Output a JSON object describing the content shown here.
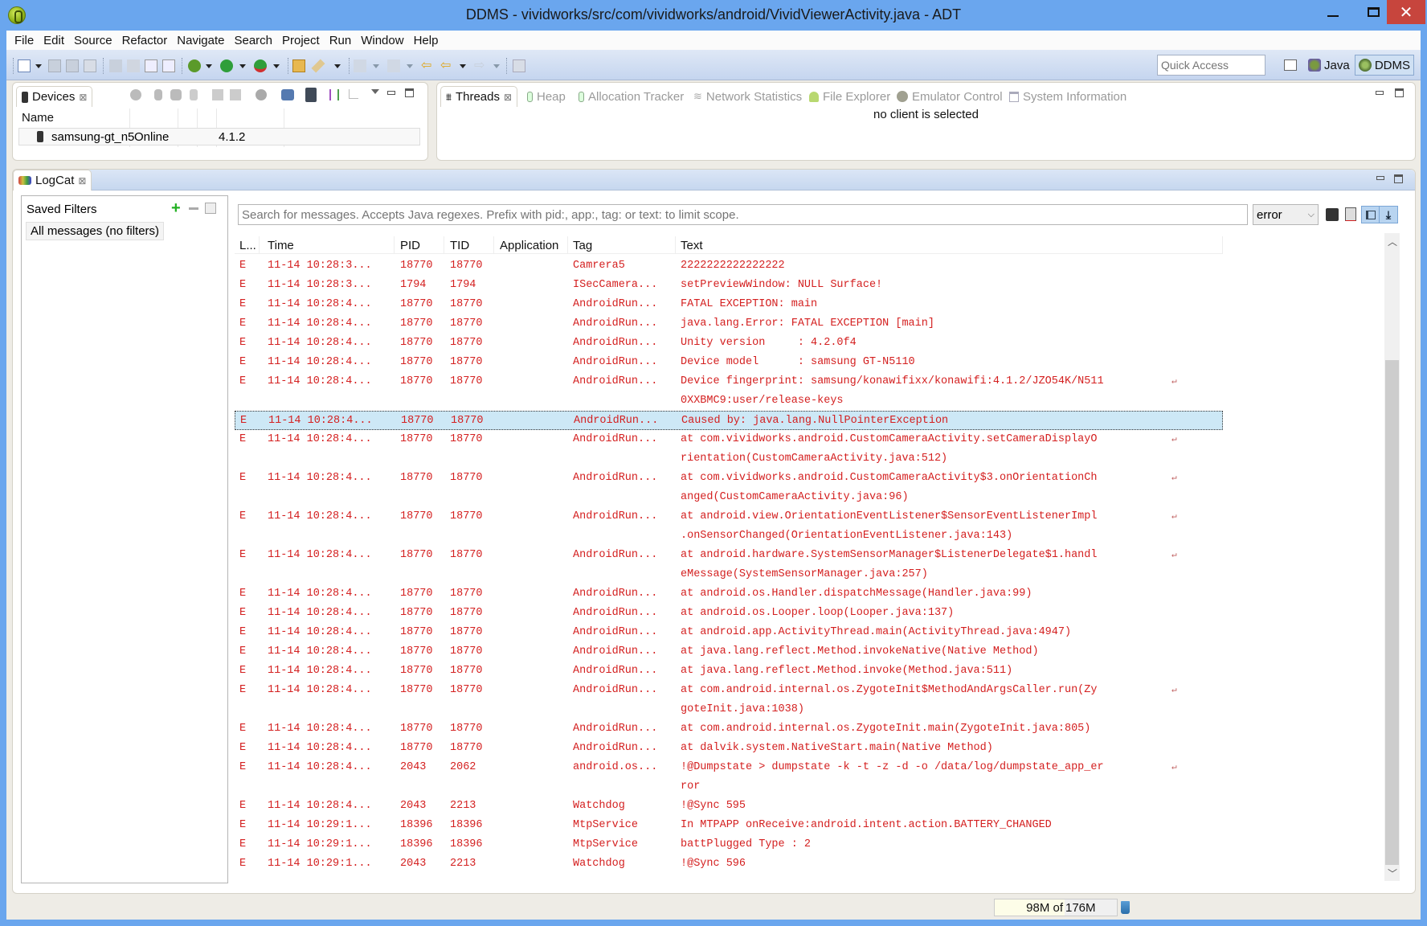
{
  "window": {
    "title": "DDMS - vividworks/src/com/vividworks/android/VividViewerActivity.java - ADT",
    "minimize": "minimize",
    "maximize": "maximize",
    "close": "✕"
  },
  "menu": [
    "File",
    "Edit",
    "Source",
    "Refactor",
    "Navigate",
    "Search",
    "Project",
    "Run",
    "Window",
    "Help"
  ],
  "toolbar": {
    "quick_access_placeholder": "Quick Access",
    "perspectives": [
      {
        "label": "Java",
        "active": false
      },
      {
        "label": "DDMS",
        "active": true
      }
    ]
  },
  "devices": {
    "tab_label": "Devices",
    "columns": [
      "Name",
      "",
      "",
      "",
      ""
    ],
    "rows": [
      {
        "name": "samsung-gt_n5",
        "status": "Online",
        "version": "4.1.2"
      }
    ]
  },
  "client_tabs": {
    "tabs": [
      {
        "label": "Threads",
        "active": true
      },
      {
        "label": "Heap",
        "active": false
      },
      {
        "label": "Allocation Tracker",
        "active": false
      },
      {
        "label": "Network Statistics",
        "active": false
      },
      {
        "label": "File Explorer",
        "active": false
      },
      {
        "label": "Emulator Control",
        "active": false
      },
      {
        "label": "System Information",
        "active": false
      }
    ],
    "message": "no client is selected"
  },
  "logcat": {
    "tab_label": "LogCat",
    "saved_filters_label": "Saved Filters",
    "filters": [
      "All messages (no filters)"
    ],
    "search_placeholder": "Search for messages. Accepts Java regexes. Prefix with pid:, app:, tag: or text: to limit scope.",
    "level": "error",
    "columns": [
      "L...",
      "Time",
      "PID",
      "TID",
      "Application",
      "Tag",
      "Text"
    ],
    "rows": [
      {
        "level": "E",
        "time": "11-14 10:28:3...",
        "pid": "18770",
        "tid": "18770",
        "app": "",
        "tag": "Camrera5",
        "text": [
          "2222222222222222"
        ]
      },
      {
        "level": "E",
        "time": "11-14 10:28:3...",
        "pid": "1794",
        "tid": "1794",
        "app": "",
        "tag": "ISecCamera...",
        "text": [
          "setPreviewWindow: NULL Surface!"
        ]
      },
      {
        "level": "E",
        "time": "11-14 10:28:4...",
        "pid": "18770",
        "tid": "18770",
        "app": "",
        "tag": "AndroidRun...",
        "text": [
          "FATAL EXCEPTION: main"
        ]
      },
      {
        "level": "E",
        "time": "11-14 10:28:4...",
        "pid": "18770",
        "tid": "18770",
        "app": "",
        "tag": "AndroidRun...",
        "text": [
          "java.lang.Error: FATAL EXCEPTION [main]"
        ]
      },
      {
        "level": "E",
        "time": "11-14 10:28:4...",
        "pid": "18770",
        "tid": "18770",
        "app": "",
        "tag": "AndroidRun...",
        "text": [
          "Unity version     : 4.2.0f4"
        ]
      },
      {
        "level": "E",
        "time": "11-14 10:28:4...",
        "pid": "18770",
        "tid": "18770",
        "app": "",
        "tag": "AndroidRun...",
        "text": [
          "Device model      : samsung GT-N5110"
        ]
      },
      {
        "level": "E",
        "time": "11-14 10:28:4...",
        "pid": "18770",
        "tid": "18770",
        "app": "",
        "tag": "AndroidRun...",
        "text": [
          "Device fingerprint: samsung/konawifixx/konawifi:4.1.2/JZO54K/N511",
          "0XXBMC9:user/release-keys"
        ]
      },
      {
        "level": "E",
        "time": "11-14 10:28:4...",
        "pid": "18770",
        "tid": "18770",
        "app": "",
        "tag": "AndroidRun...",
        "text": [
          "Caused by: java.lang.NullPointerException"
        ],
        "selected": true
      },
      {
        "level": "E",
        "time": "11-14 10:28:4...",
        "pid": "18770",
        "tid": "18770",
        "app": "",
        "tag": "AndroidRun...",
        "text": [
          "at com.vividworks.android.CustomCameraActivity.setCameraDisplayO",
          "rientation(CustomCameraActivity.java:512)"
        ]
      },
      {
        "level": "E",
        "time": "11-14 10:28:4...",
        "pid": "18770",
        "tid": "18770",
        "app": "",
        "tag": "AndroidRun...",
        "text": [
          "at com.vividworks.android.CustomCameraActivity$3.onOrientationCh",
          "anged(CustomCameraActivity.java:96)"
        ]
      },
      {
        "level": "E",
        "time": "11-14 10:28:4...",
        "pid": "18770",
        "tid": "18770",
        "app": "",
        "tag": "AndroidRun...",
        "text": [
          "at android.view.OrientationEventListener$SensorEventListenerImpl",
          ".onSensorChanged(OrientationEventListener.java:143)"
        ]
      },
      {
        "level": "E",
        "time": "11-14 10:28:4...",
        "pid": "18770",
        "tid": "18770",
        "app": "",
        "tag": "AndroidRun...",
        "text": [
          "at android.hardware.SystemSensorManager$ListenerDelegate$1.handl",
          "eMessage(SystemSensorManager.java:257)"
        ]
      },
      {
        "level": "E",
        "time": "11-14 10:28:4...",
        "pid": "18770",
        "tid": "18770",
        "app": "",
        "tag": "AndroidRun...",
        "text": [
          "at android.os.Handler.dispatchMessage(Handler.java:99)"
        ]
      },
      {
        "level": "E",
        "time": "11-14 10:28:4...",
        "pid": "18770",
        "tid": "18770",
        "app": "",
        "tag": "AndroidRun...",
        "text": [
          "at android.os.Looper.loop(Looper.java:137)"
        ]
      },
      {
        "level": "E",
        "time": "11-14 10:28:4...",
        "pid": "18770",
        "tid": "18770",
        "app": "",
        "tag": "AndroidRun...",
        "text": [
          "at android.app.ActivityThread.main(ActivityThread.java:4947)"
        ]
      },
      {
        "level": "E",
        "time": "11-14 10:28:4...",
        "pid": "18770",
        "tid": "18770",
        "app": "",
        "tag": "AndroidRun...",
        "text": [
          "at java.lang.reflect.Method.invokeNative(Native Method)"
        ]
      },
      {
        "level": "E",
        "time": "11-14 10:28:4...",
        "pid": "18770",
        "tid": "18770",
        "app": "",
        "tag": "AndroidRun...",
        "text": [
          "at java.lang.reflect.Method.invoke(Method.java:511)"
        ]
      },
      {
        "level": "E",
        "time": "11-14 10:28:4...",
        "pid": "18770",
        "tid": "18770",
        "app": "",
        "tag": "AndroidRun...",
        "text": [
          "at com.android.internal.os.ZygoteInit$MethodAndArgsCaller.run(Zy",
          "goteInit.java:1038)"
        ]
      },
      {
        "level": "E",
        "time": "11-14 10:28:4...",
        "pid": "18770",
        "tid": "18770",
        "app": "",
        "tag": "AndroidRun...",
        "text": [
          "at com.android.internal.os.ZygoteInit.main(ZygoteInit.java:805)"
        ]
      },
      {
        "level": "E",
        "time": "11-14 10:28:4...",
        "pid": "18770",
        "tid": "18770",
        "app": "",
        "tag": "AndroidRun...",
        "text": [
          "at dalvik.system.NativeStart.main(Native Method)"
        ]
      },
      {
        "level": "E",
        "time": "11-14 10:28:4...",
        "pid": "2043",
        "tid": "2062",
        "app": "",
        "tag": "android.os...",
        "text": [
          "!@Dumpstate > dumpstate -k -t -z -d -o /data/log/dumpstate_app_er",
          "ror"
        ]
      },
      {
        "level": "E",
        "time": "11-14 10:28:4...",
        "pid": "2043",
        "tid": "2213",
        "app": "",
        "tag": "Watchdog",
        "text": [
          "!@Sync 595"
        ]
      },
      {
        "level": "E",
        "time": "11-14 10:29:1...",
        "pid": "18396",
        "tid": "18396",
        "app": "",
        "tag": "MtpService",
        "text": [
          "In MTPAPP onReceive:android.intent.action.BATTERY_CHANGED"
        ]
      },
      {
        "level": "E",
        "time": "11-14 10:29:1...",
        "pid": "18396",
        "tid": "18396",
        "app": "",
        "tag": "MtpService",
        "text": [
          "battPlugged Type : 2"
        ]
      },
      {
        "level": "E",
        "time": "11-14 10:29:1...",
        "pid": "2043",
        "tid": "2213",
        "app": "",
        "tag": "Watchdog",
        "text": [
          "!@Sync 596"
        ]
      }
    ]
  },
  "status": {
    "heap_used": "98M of",
    "heap_total": "176M"
  },
  "colors": {
    "error_text": "#d42020",
    "selection": "#cde8f6",
    "titlebar": "#6aa6ee",
    "close_button": "#c7453d"
  }
}
